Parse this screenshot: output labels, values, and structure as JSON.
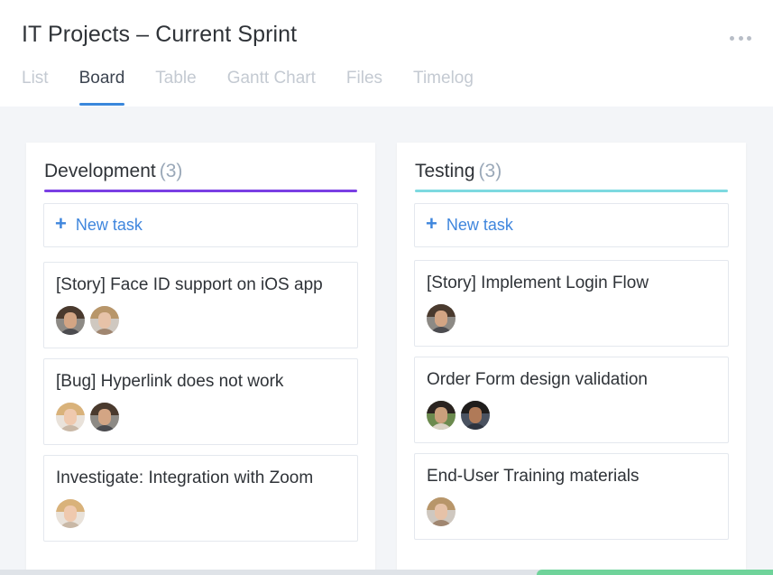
{
  "project": {
    "title": "IT Projects – Current Sprint"
  },
  "tabs": [
    {
      "label": "List"
    },
    {
      "label": "Board"
    },
    {
      "label": "Table"
    },
    {
      "label": "Gantt Chart"
    },
    {
      "label": "Files"
    },
    {
      "label": "Timelog"
    }
  ],
  "active_tab": "Board",
  "columns": [
    {
      "title": "Development",
      "count": "(3)",
      "accent_color": "#7a3fe4",
      "new_task_label": "New task",
      "cards": [
        {
          "title": "[Story] Face ID support on iOS app",
          "assignees": [
            "man-glasses",
            "woman-light"
          ]
        },
        {
          "title": "[Bug] Hyperlink does not work",
          "assignees": [
            "woman-blonde",
            "man-glasses"
          ]
        },
        {
          "title": "Investigate: Integration with Zoom",
          "assignees": [
            "woman-blonde"
          ]
        }
      ]
    },
    {
      "title": "Testing",
      "count": "(3)",
      "accent_color": "#7dd9e0",
      "new_task_label": "New task",
      "cards": [
        {
          "title": "[Story] Implement Login Flow",
          "assignees": [
            "man-glasses"
          ]
        },
        {
          "title": "Order Form design validation",
          "assignees": [
            "woman-dark",
            "man-dark"
          ]
        },
        {
          "title": "End-User Training materials",
          "assignees": [
            "woman-light"
          ]
        }
      ]
    }
  ],
  "colors": {
    "link": "#3f86dd",
    "tab_underline": "#3a87dc"
  }
}
